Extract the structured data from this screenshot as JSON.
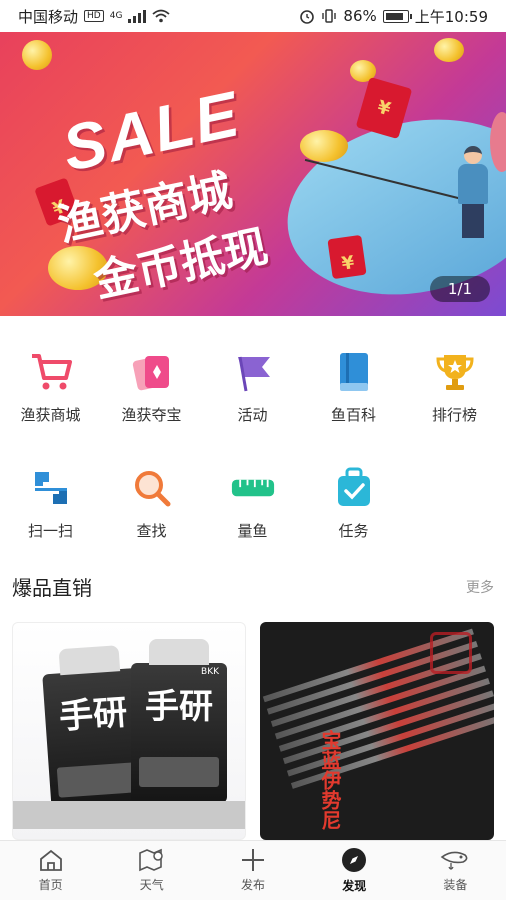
{
  "status_bar": {
    "carrier": "中国移动",
    "hd": "HD",
    "network": "4G",
    "battery": "86%",
    "time": "上午10:59"
  },
  "banner": {
    "headline": "SALE",
    "line1": "渔获商城",
    "line2": "金币抵现",
    "page_indicator": "1/1"
  },
  "quick_actions_row1": [
    {
      "label": "渔获商城",
      "icon": "shopping-cart-icon"
    },
    {
      "label": "渔获夺宝",
      "icon": "cards-icon"
    },
    {
      "label": "活动",
      "icon": "flag-icon"
    },
    {
      "label": "鱼百科",
      "icon": "book-icon"
    },
    {
      "label": "排行榜",
      "icon": "trophy-icon"
    }
  ],
  "quick_actions_row2": [
    {
      "label": "扫一扫",
      "icon": "scan-icon"
    },
    {
      "label": "查找",
      "icon": "search-icon"
    },
    {
      "label": "量鱼",
      "icon": "ruler-icon"
    },
    {
      "label": "任务",
      "icon": "task-bag-icon"
    }
  ],
  "hot_sales": {
    "title": "爆品直销",
    "more": "更多",
    "products": [
      {
        "image_text": "手研",
        "brand": "BKK"
      },
      {
        "image_text": "宝蓝伊势尼"
      }
    ]
  },
  "tab_bar": [
    {
      "label": "首页",
      "icon": "home-icon",
      "active": false
    },
    {
      "label": "天气",
      "icon": "weather-icon",
      "active": false
    },
    {
      "label": "发布",
      "icon": "plus-icon",
      "active": false
    },
    {
      "label": "发现",
      "icon": "compass-icon",
      "active": true
    },
    {
      "label": "装备",
      "icon": "fishing-lure-icon",
      "active": false
    }
  ],
  "colors": {
    "accent_pink": "#e8415c",
    "accent_orange": "#f07a3a",
    "accent_purple": "#8a63d2",
    "accent_blue": "#2f8fd8",
    "accent_gold": "#f2b21d",
    "accent_green": "#22c28a"
  }
}
